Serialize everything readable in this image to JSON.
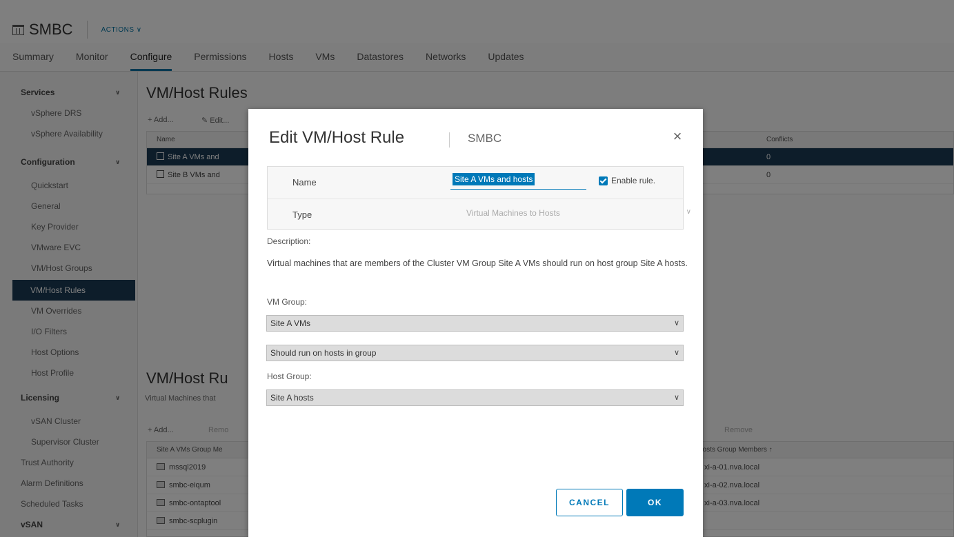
{
  "header": {
    "object_name": "SMBC",
    "actions_label": "ACTIONS ∨"
  },
  "tabs": [
    {
      "label": "Summary"
    },
    {
      "label": "Monitor"
    },
    {
      "label": "Configure"
    },
    {
      "label": "Permissions"
    },
    {
      "label": "Hosts"
    },
    {
      "label": "VMs"
    },
    {
      "label": "Datastores"
    },
    {
      "label": "Networks"
    },
    {
      "label": "Updates"
    }
  ],
  "sidebar": {
    "items": [
      {
        "label": "Services"
      },
      {
        "label": "vSphere DRS"
      },
      {
        "label": "vSphere Availability"
      },
      {
        "label": "Configuration"
      },
      {
        "label": "Quickstart"
      },
      {
        "label": "General"
      },
      {
        "label": "Key Provider"
      },
      {
        "label": "VMware EVC"
      },
      {
        "label": "VM/Host Groups"
      },
      {
        "label": "VM/Host Rules"
      },
      {
        "label": "VM Overrides"
      },
      {
        "label": "I/O Filters"
      },
      {
        "label": "Host Options"
      },
      {
        "label": "Host Profile"
      },
      {
        "label": "Licensing"
      },
      {
        "label": "vSAN Cluster"
      },
      {
        "label": "Supervisor Cluster"
      },
      {
        "label": "Trust Authority"
      },
      {
        "label": "Alarm Definitions"
      },
      {
        "label": "Scheduled Tasks"
      },
      {
        "label": "vSAN"
      }
    ]
  },
  "rules_section": {
    "title": "VM/Host Rules",
    "add_label": "+ Add...",
    "edit_label": "Edit...",
    "col_name": "Name",
    "col_conflicts": "Conflicts",
    "rows": [
      {
        "name": "Site A VMs and",
        "conflicts": "0"
      },
      {
        "name": "Site B VMs and",
        "conflicts": "0"
      }
    ]
  },
  "details_section": {
    "title": "VM/Host Ru",
    "subtitle": "Virtual Machines that",
    "add_label": "+ Add...",
    "remove_label": "Remo",
    "remove_right_label": "Remove",
    "col_left": "Site A VMs Group Me",
    "col_right": "hosts Group Members ↑",
    "vm_rows": [
      {
        "name": "mssql2019",
        "host": "xi-a-01.nva.local"
      },
      {
        "name": "smbc-eiqum",
        "host": "xi-a-02.nva.local"
      },
      {
        "name": "smbc-ontaptool",
        "host": "xi-a-03.nva.local"
      },
      {
        "name": "smbc-scplugin",
        "host": ""
      }
    ]
  },
  "modal": {
    "title": "Edit VM/Host Rule",
    "subtitle": "SMBC",
    "close_glyph": "×",
    "name_label": "Name",
    "name_value": "Site A VMs and hosts",
    "enable_label": "Enable rule.",
    "enabled": true,
    "type_label": "Type",
    "type_value": "Virtual Machines to Hosts",
    "description_label": "Description:",
    "description_text": "Virtual machines that are members of the Cluster VM Group Site A VMs should run on host group Site A hosts.",
    "vm_group_label": "VM Group:",
    "vm_group_value": "Site A VMs",
    "relation_value": "Should run on hosts in group",
    "host_group_label": "Host Group:",
    "host_group_value": "Site A hosts",
    "cancel_label": "CANCEL",
    "ok_label": "OK"
  },
  "colors": {
    "accent": "#0079b8",
    "selected_row": "#1a3a55"
  }
}
